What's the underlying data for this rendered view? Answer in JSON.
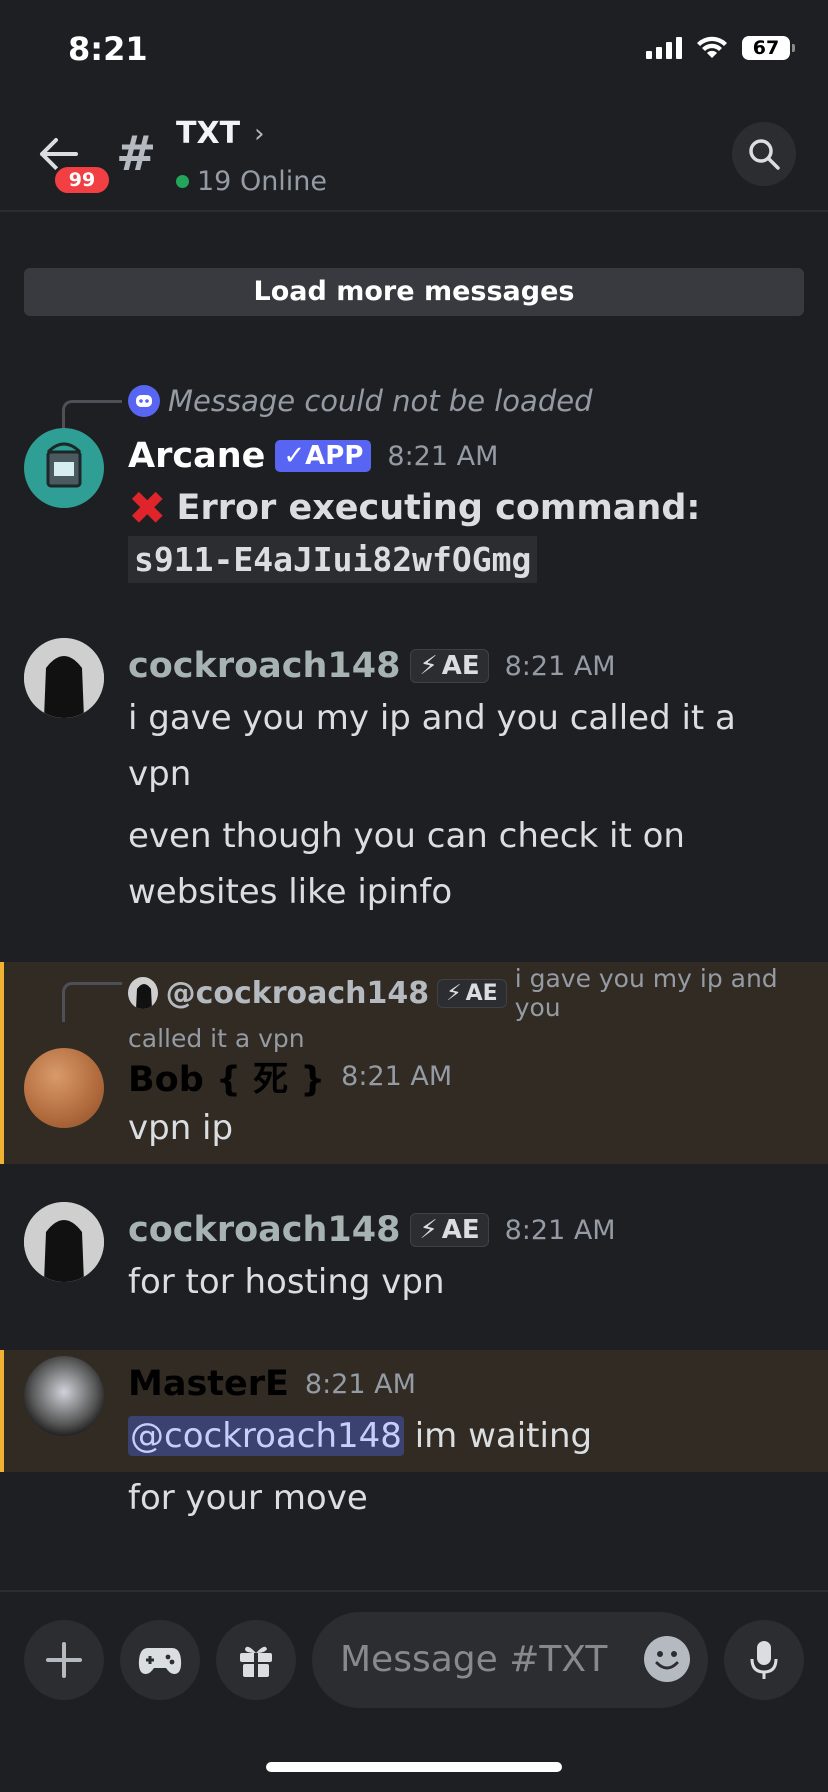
{
  "status": {
    "time": "8:21",
    "battery": "67"
  },
  "header": {
    "badge": "99",
    "channel": "TXT",
    "online": "19 Online"
  },
  "load_more": "Load more messages",
  "messages": [
    {
      "reply_text": "Message could not be loaded",
      "username": "Arcane",
      "app_tag": "✓APP",
      "time": "8:21 AM",
      "line1": "Error executing command:",
      "code": "s911-E4aJIui82wfOGmg",
      "name_color": "#ffffff"
    },
    {
      "username": "cockroach148",
      "tag": "AE",
      "time": "8:21 AM",
      "lines": [
        "i gave you my ip and you called it a",
        "vpn",
        "even though you can check it on",
        "websites like ipinfo"
      ],
      "name_color": "#a7b3b0"
    },
    {
      "reply_user": "@cockroach148",
      "reply_tag": "AE",
      "reply_text_1": "i gave you my ip and you",
      "reply_text_2": "called it a vpn",
      "username": "Bob { 死 }",
      "time": "8:21 AM",
      "lines": [
        "vpn ip"
      ],
      "name_color": "#000000"
    },
    {
      "username": "cockroach148",
      "tag": "AE",
      "time": "8:21 AM",
      "lines": [
        "for tor hosting vpn"
      ],
      "name_color": "#a7b3b0"
    },
    {
      "username": "MasterE",
      "time": "8:21 AM",
      "mention": "@cockroach148",
      "after_mention": " im waiting",
      "lines": [
        "for your move"
      ],
      "name_color": "#000000"
    }
  ],
  "composer": {
    "placeholder": "Message #TXT"
  }
}
